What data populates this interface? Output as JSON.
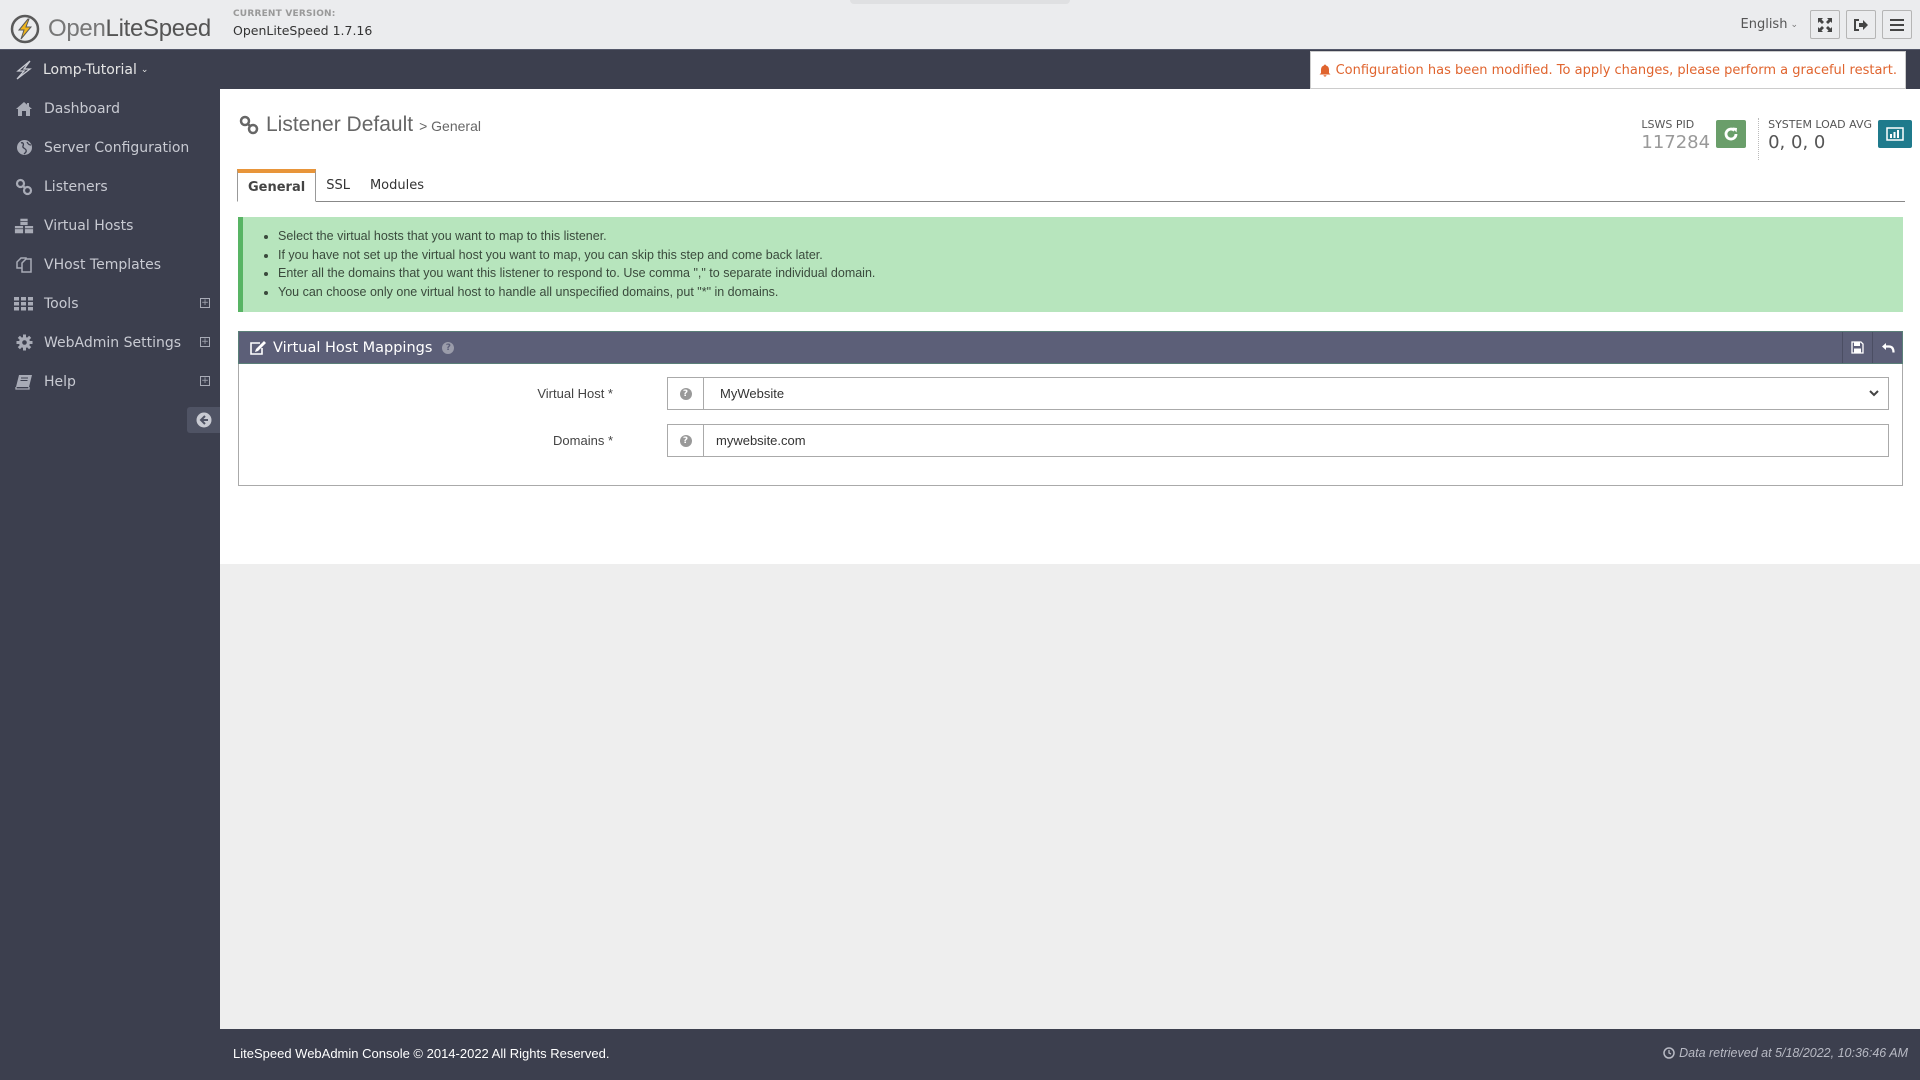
{
  "app": {
    "logo_light": "Open",
    "logo_bold": "LiteSpeed",
    "version_label": "CURRENT VERSION:",
    "version_value": "OpenLiteSpeed 1.7.16"
  },
  "topbar": {
    "language": "English",
    "buttons": [
      {
        "name": "fullscreen",
        "icon": "expand-icon"
      },
      {
        "name": "logout",
        "icon": "sign-out-icon"
      },
      {
        "name": "menu",
        "icon": "hamburger-icon"
      }
    ]
  },
  "site_switcher": {
    "label": "Lomp-Tutorial"
  },
  "alert": {
    "icon": "bell-icon",
    "text": "Configuration has been modified. To apply changes, please perform a graceful restart.",
    "color": "#e0642e"
  },
  "sidebar": {
    "items": [
      {
        "label": "Dashboard",
        "icon": "home-icon",
        "expandable": false
      },
      {
        "label": "Server Configuration",
        "icon": "globe-icon",
        "expandable": false
      },
      {
        "label": "Listeners",
        "icon": "link-icon",
        "expandable": false
      },
      {
        "label": "Virtual Hosts",
        "icon": "cubes-icon",
        "expandable": false
      },
      {
        "label": "VHost Templates",
        "icon": "copy-icon",
        "expandable": false
      },
      {
        "label": "Tools",
        "icon": "grid-icon",
        "expandable": true
      },
      {
        "label": "WebAdmin Settings",
        "icon": "gear-icon",
        "expandable": true
      },
      {
        "label": "Help",
        "icon": "book-icon",
        "expandable": true
      }
    ],
    "expand_symbol": "+"
  },
  "page": {
    "title": "Listener Default",
    "subtitle": "> General"
  },
  "stats": {
    "pid_label": "LSWS PID",
    "pid_value": "117284",
    "load_label": "SYSTEM LOAD AVG",
    "load_value": "0, 0, 0",
    "restart_color": "#6a9e6a",
    "chart_color": "#1f7a8c"
  },
  "tabs": [
    {
      "label": "General",
      "active": true
    },
    {
      "label": "SSL",
      "active": false
    },
    {
      "label": "Modules",
      "active": false
    }
  ],
  "info": {
    "items": [
      "Select the virtual hosts that you want to map to this listener.",
      "If you have not set up the virtual host you want to map, you can skip this step and come back later.",
      "Enter all the domains that you want this listener to respond to. Use comma \",\" to separate individual domain.",
      "You can choose only one virtual host to handle all unspecified domains, put \"*\" in domains."
    ]
  },
  "panel": {
    "title": "Virtual Host Mappings",
    "help_symbol": "?",
    "fields": [
      {
        "label": "Virtual Host *",
        "type": "select",
        "value": "MyWebsite",
        "options": [
          "MyWebsite"
        ]
      },
      {
        "label": "Domains *",
        "type": "text",
        "value": "mywebsite.com"
      }
    ]
  },
  "footer": {
    "copyright": "LiteSpeed WebAdmin Console © 2014-2022 All Rights Reserved.",
    "retrieved": "Data retrieved at 5/18/2022, 10:36:46 AM"
  }
}
